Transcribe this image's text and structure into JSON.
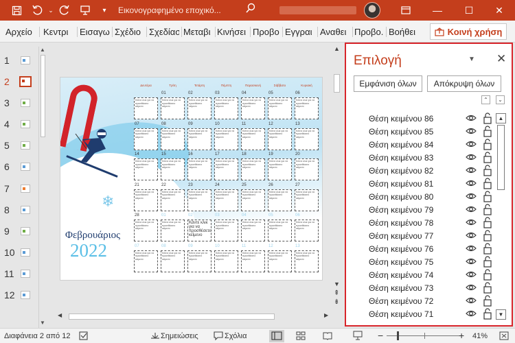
{
  "window": {
    "doc_title": "Εικονογραφημένο εποχικό...",
    "minimize": "—",
    "maximize": "☐",
    "close": "✕"
  },
  "tabs": [
    "Αρχείο",
    "Κεντρι",
    "Εισαγω",
    "Σχέδιο",
    "Σχεδίασ",
    "Μεταβι",
    "Κινήσει",
    "Προβο",
    "Εγγραι",
    "Αναθει",
    "Προβο.",
    "Βοήθει"
  ],
  "share_label": "Κοινή χρήση",
  "thumbnails": {
    "slides": [
      "1",
      "2",
      "3",
      "4",
      "5",
      "6",
      "7",
      "8",
      "9",
      "10",
      "11",
      "12"
    ],
    "active": "2",
    "accent_colors": [
      "#5b9bd5",
      "#c43e1c",
      "#70ad47",
      "#70ad47",
      "#70ad47",
      "#5b9bd5",
      "#ed7d31",
      "#5b9bd5",
      "#70ad47",
      "#5b9bd5",
      "#5b9bd5",
      "#5b9bd5"
    ]
  },
  "slide": {
    "month": "Φεβρουάριος",
    "year": "2022",
    "weekdays": [
      "Δευτέρα",
      "Τρίτη",
      "Τετάρτη",
      "Πέμπτη",
      "Παρασκευή",
      "Σάββατο",
      "Κυριακή"
    ],
    "days": [
      "",
      "01",
      "02",
      "03",
      "04",
      "05",
      "06",
      "07",
      "08",
      "09",
      "10",
      "11",
      "12",
      "13",
      "14",
      "15",
      "16",
      "17",
      "18",
      "19",
      "20",
      "21",
      "22",
      "23",
      "24",
      "25",
      "26",
      "27",
      "28",
      "01",
      "02",
      "03",
      "04",
      "05",
      "06",
      "07",
      "08",
      "09",
      "10",
      "11",
      "12",
      "13"
    ],
    "cell_text": "Κάντε κλικ για να προσθέσετε κείμενο",
    "big_cell_text": "Κάντε κλικ για να προσθέσετε κείμενο"
  },
  "selection_pane": {
    "title": "Επιλογή",
    "show_all": "Εμφάνιση όλων",
    "hide_all": "Απόκρυψη όλων",
    "items": [
      "Θέση κειμένου 86",
      "Θέση κειμένου 85",
      "Θέση κειμένου 84",
      "Θέση κειμένου 83",
      "Θέση κειμένου 82",
      "Θέση κειμένου 81",
      "Θέση κειμένου 80",
      "Θέση κειμένου 79",
      "Θέση κειμένου 78",
      "Θέση κειμένου 77",
      "Θέση κειμένου 76",
      "Θέση κειμένου 75",
      "Θέση κειμένου 74",
      "Θέση κειμένου 73",
      "Θέση κειμένου 72",
      "Θέση κειμένου 71"
    ]
  },
  "status": {
    "slide_counter": "Διαφάνεια 2 από 12",
    "notes": "Σημειώσεις",
    "comments": "Σχόλια",
    "zoom": "41%"
  },
  "colors": {
    "accent": "#c43e1c",
    "highlight_border": "#d8242a"
  }
}
